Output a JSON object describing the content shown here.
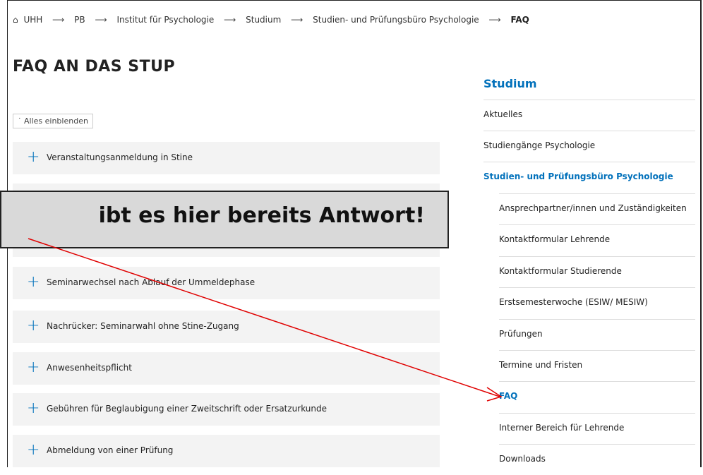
{
  "breadcrumb": {
    "home_label": "UHH",
    "items": [
      "PB",
      "Institut für Psychologie",
      "Studium",
      "Studien- und Prüfungsbüro Psychologie",
      "FAQ"
    ]
  },
  "page_title": "FAQ AN DAS STUP",
  "expand_all": "Alles einblenden",
  "accordion": [
    "Veranstaltungsanmeldung in Stine",
    "Seminarwechsel nach Ablauf der Ummeldephase",
    "Nachrücker: Seminarwahl ohne Stine-Zugang",
    "Anwesenheitspflicht",
    "Gebühren für Beglaubigung einer Zweitschrift oder Ersatzurkunde",
    "Abmeldung von einer Prüfung"
  ],
  "sidebar": {
    "title": "Studium",
    "items": [
      "Aktuelles",
      "Studiengänge Psychologie",
      "Studien- und Prüfungsbüro Psychologie",
      "Ansprechpartner/innen und Zuständigkeiten",
      "Kontaktformular Lehrende",
      "Kontaktformular Studierende",
      "Erstsemesterwoche (ESIW/ MESIW)",
      "Prüfungen",
      "Termine und Fristen",
      "FAQ",
      "Interner Bereich für Lehrende",
      "Downloads"
    ]
  },
  "callout": {
    "text": "ibt es hier bereits Antwort!"
  },
  "colors": {
    "accent": "#0271bb",
    "arrow": "#e00000",
    "callout_bg": "#d9d9d9"
  }
}
